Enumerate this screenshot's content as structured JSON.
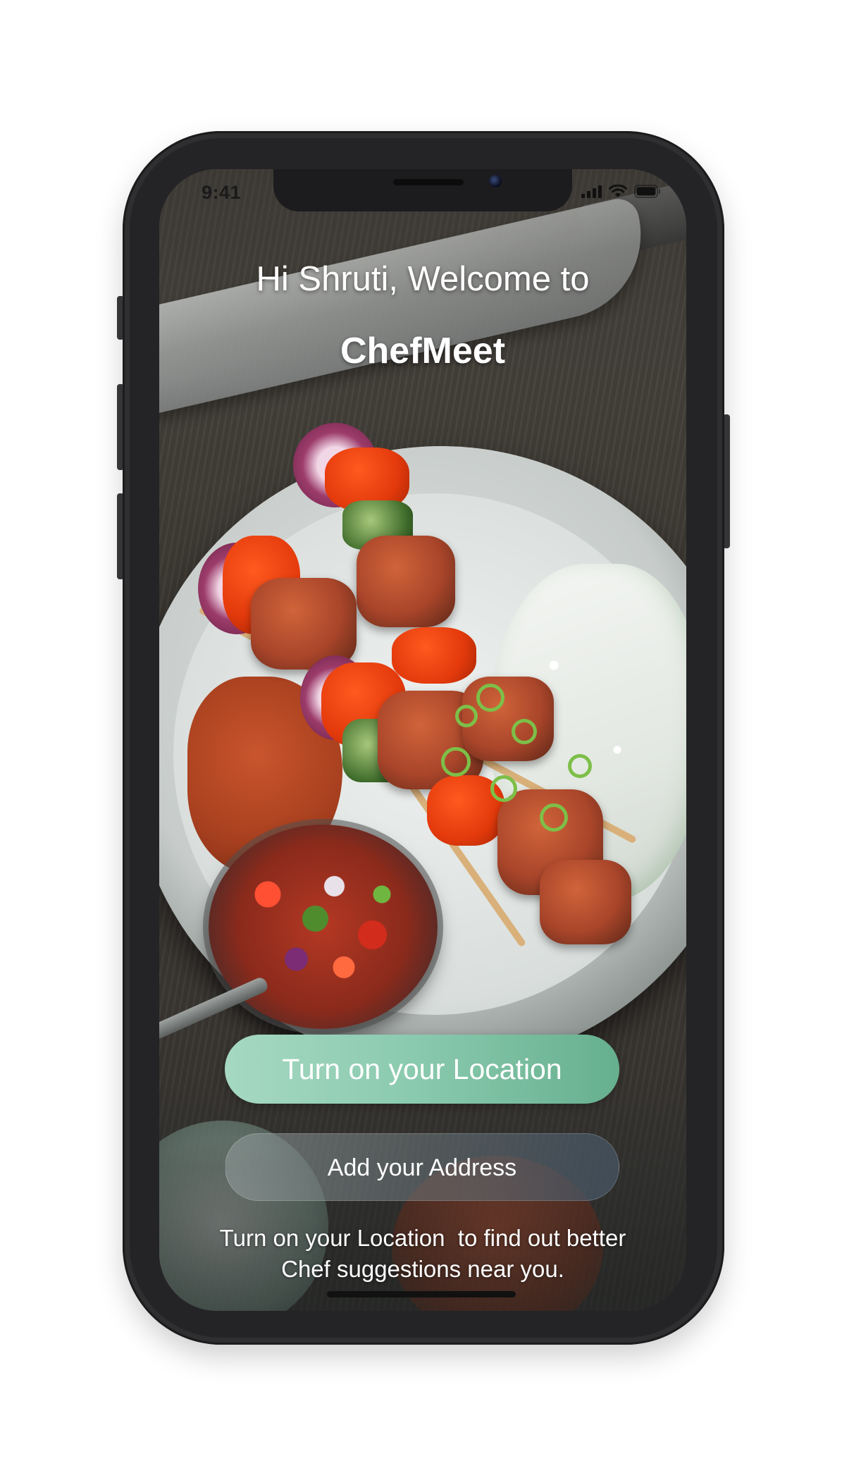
{
  "status_bar": {
    "time": "9:41",
    "icons": [
      "cellular-signal-icon",
      "wifi-icon",
      "battery-icon"
    ]
  },
  "welcome": {
    "greeting": "Hi Shruti, Welcome to",
    "app_name": "ChefMeet"
  },
  "actions": {
    "location_button": "Turn on your Location",
    "address_button": "Add your Address"
  },
  "hint": {
    "line1": "Turn on your Location  to find out better",
    "line2": "Chef suggestions near you."
  },
  "colors": {
    "primary_button": "#8ccbb0",
    "secondary_button": "#6e7f8c",
    "text": "#ffffff",
    "device_frame": "#2f2f31"
  }
}
